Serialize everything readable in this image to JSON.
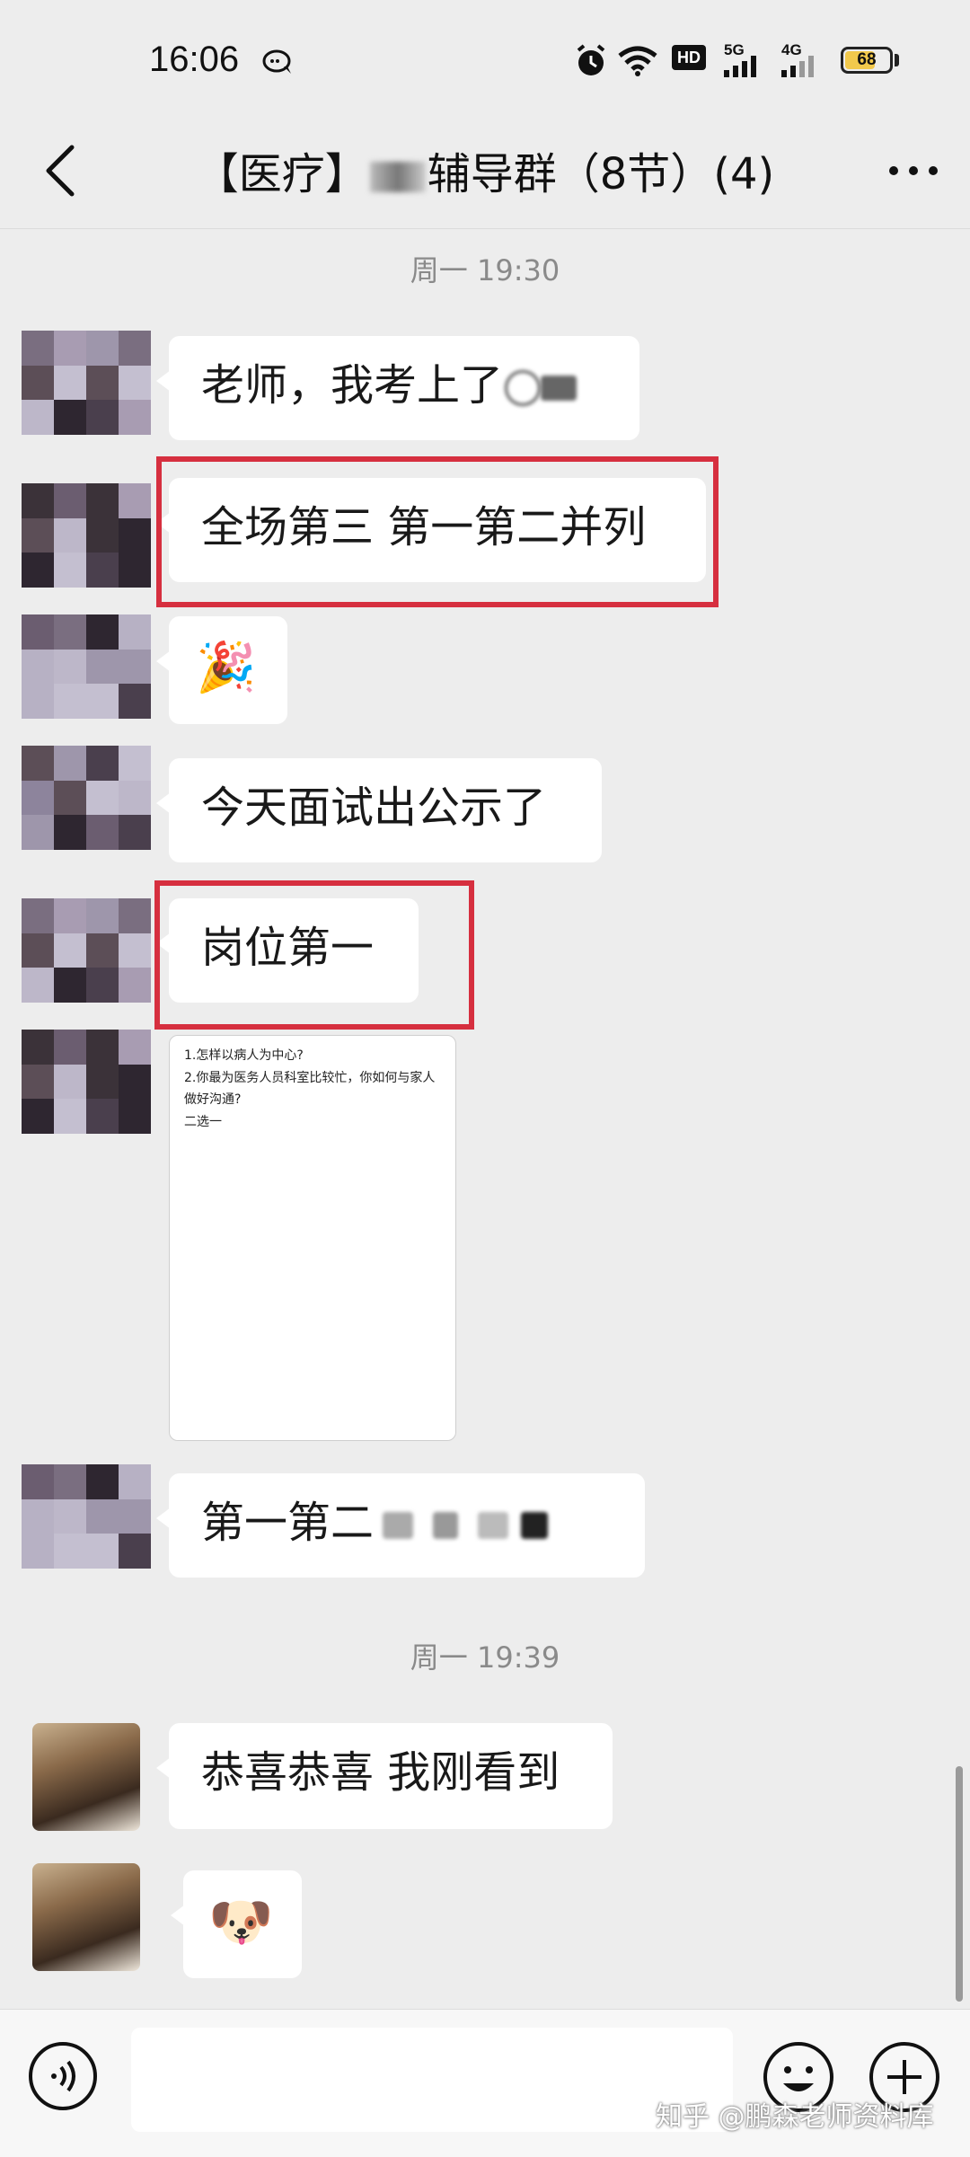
{
  "status_bar": {
    "time": "16:06",
    "hd_label": "HD",
    "net1": "5G",
    "net2": "4G",
    "battery": "68",
    "battery_level": 0.68
  },
  "header": {
    "title_prefix": "【医疗】",
    "title_suffix": "辅导群（8节）(4)",
    "back_icon": "chevron-left-icon",
    "more_icon": "ellipsis-icon"
  },
  "chat": {
    "timestamp_1": "周一 19:30",
    "timestamp_2": "周一 19:39",
    "messages": [
      {
        "text": "老师，我考上了"
      },
      {
        "text": "全场第三 第一第二并列"
      },
      {
        "sticker": "party-popper-icon",
        "glyph": "🎉"
      },
      {
        "text": "今天面试出公示了"
      },
      {
        "text": "岗位第一"
      },
      {
        "image_lines": [
          "1.怎样以病人为中心?",
          "2.你最为医务人员科室比较忙，你如何与家人做好沟通?",
          "二选一"
        ]
      },
      {
        "text": "第一第二"
      },
      {
        "text": "恭喜恭喜 我刚看到"
      },
      {
        "sticker": "doge-roses-sticker",
        "glyph": "🐶"
      }
    ]
  },
  "colors": {
    "background": "#ededed",
    "bubble": "#ffffff",
    "highlight": "#d62f3f",
    "timestamp": "#8a8a8a"
  },
  "input_bar": {
    "voice_icon": "voice-icon",
    "emoji_icon": "emoji-icon",
    "plus_icon": "plus-icon",
    "input_value": ""
  },
  "watermark": "知乎 @鹏森老师资料库"
}
